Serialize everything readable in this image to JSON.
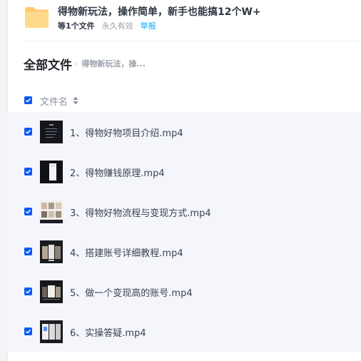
{
  "share": {
    "title": "得物新玩法，操作简单，新手也能搞12个W+",
    "file_count": "等1个文件",
    "validity": "永久有效",
    "report_label": "举报"
  },
  "breadcrumb": {
    "root": "全部文件",
    "separator": "›",
    "current": "得物新玩法，操..."
  },
  "list_header": {
    "column_label": "文件名"
  },
  "files": [
    {
      "name": "1、得物好物项目介绍.mp4",
      "checked": true
    },
    {
      "name": "2、得物赚钱原理.mp4",
      "checked": true
    },
    {
      "name": "3、得物好物流程与变现方式.mp4",
      "checked": true
    },
    {
      "name": "4、搭建账号详细教程.mp4",
      "checked": true
    },
    {
      "name": "5、做一个变现高的账号.mp4",
      "checked": true
    },
    {
      "name": "6、实操答疑.mp4",
      "checked": true
    }
  ],
  "colors": {
    "accent": "#0a59f7",
    "link": "#06a7ff",
    "folder": "#ffc96b",
    "row_bg": "#f5f6fb"
  }
}
